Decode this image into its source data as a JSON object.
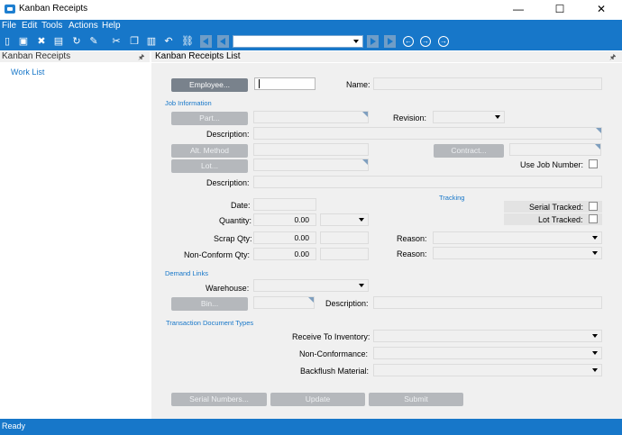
{
  "window": {
    "title": "Kanban Receipts",
    "minimize": "—",
    "maximize": "☐",
    "close": "✕"
  },
  "menu": [
    "File",
    "Edit",
    "Tools",
    "Actions",
    "Help"
  ],
  "left_panel": {
    "header": "Kanban Receipts",
    "pin": "🖈",
    "item": "Work List"
  },
  "right_panel": {
    "header": "Kanban Receipts List",
    "pin": "🖈"
  },
  "employee": {
    "button": "Employee...",
    "name_label": "Name:"
  },
  "job_info": {
    "section": "Job Information",
    "part_button": "Part...",
    "revision_label": "Revision:",
    "description_label": "Description:",
    "alt_method_button": "Alt. Method",
    "contract_button": "Contract...",
    "lot_button": "Lot...",
    "use_job_number_label": "Use Job Number:",
    "description2_label": "Description:"
  },
  "tracking": {
    "section": "Tracking",
    "serial_label": "Serial Tracked:",
    "lot_label": "Lot Tracked:"
  },
  "quantities": {
    "date_label": "Date:",
    "quantity_label": "Quantity:",
    "quantity_value": "0.00",
    "scrap_label": "Scrap Qty:",
    "scrap_value": "0.00",
    "nonconform_label": "Non-Conform Qty:",
    "nonconform_value": "0.00",
    "reason1_label": "Reason:",
    "reason2_label": "Reason:"
  },
  "demand": {
    "section": "Demand Links",
    "warehouse_label": "Warehouse:",
    "bin_button": "Bin...",
    "description_label": "Description:"
  },
  "transaction": {
    "section": "Transaction Document Types",
    "receive_label": "Receive To Inventory:",
    "nonconformance_label": "Non-Conformance:",
    "backflush_label": "Backflush Material:"
  },
  "actions": {
    "serial_numbers": "Serial Numbers...",
    "update": "Update",
    "submit": "Submit"
  },
  "status": {
    "text": "Ready"
  },
  "colors": {
    "accent": "#1777c9",
    "form_bg": "#f0f0f0",
    "button_disabled": "#b5b8bc",
    "button_active": "#79828c"
  }
}
